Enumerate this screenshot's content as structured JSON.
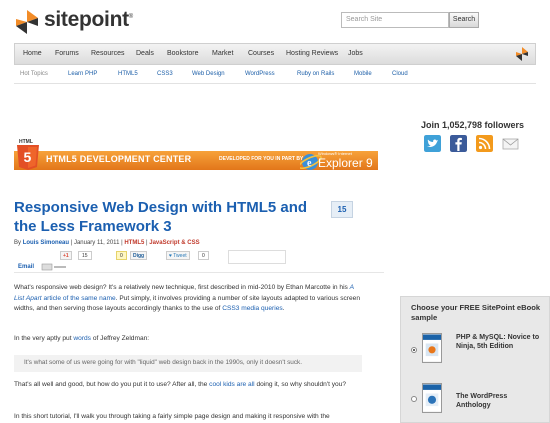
{
  "header": {
    "logo_text": "sitepoint",
    "logo_mark": "®",
    "search_placeholder": "Search Site",
    "search_button": "Search"
  },
  "nav": {
    "items": [
      "Home",
      "Forums",
      "Resources",
      "Deals",
      "Bookstore",
      "Market",
      "Courses",
      "Hosting Reviews",
      "Jobs"
    ]
  },
  "hot_topics": {
    "label": "Hot Topics",
    "links": [
      "Learn PHP",
      "HTML5",
      "CSS3",
      "Web Design",
      "WordPress",
      "Ruby on Rails",
      "Mobile",
      "Cloud"
    ]
  },
  "banner": {
    "badge_top": "HTML",
    "badge_num": "5",
    "title": "HTML5 DEVELOPMENT CENTER",
    "subtitle": "DEVELOPED FOR YOU IN PART BY",
    "ie_small": "Windows® Internet",
    "ie_big": "Explorer 9"
  },
  "article": {
    "title": "Responsive Web Design with HTML5 and the Less Framework 3",
    "comment_count": "15",
    "byline_prefix": "By",
    "author": "Louis Simoneau",
    "date": "January 11, 2011",
    "tag1": "HTML5",
    "tag2": "JavaScript & CSS",
    "share": {
      "gplus_label": "+1",
      "gplus_count": "15",
      "digg_count": "0",
      "digg_label": "Digg",
      "tweet_label": "Tweet",
      "tweet_count": "0",
      "email_label": "Email"
    },
    "p1_a": "What's responsive web design? It's a relatively new technique, first described in mid-2010 by Ethan Marcotte in his ",
    "p1_link1": "A List Apart",
    "p1_link2": "article of the same name",
    "p1_b": ". Put simply, it involves providing a number of site layouts adapted to various screen widths, and then serving those layouts accordingly thanks to the use of ",
    "p1_link3": "CSS3 media queries",
    "p1_c": ".",
    "p2_a": "In the very aptly put ",
    "p2_link": "words",
    "p2_b": " of Jeffrey Zeldman:",
    "quote": "It's what some of us were going for with \"liquid\" web design back in the 1990s, only it doesn't suck.",
    "p3_a": "That's all well and good, but how do you put it to use? After all, the ",
    "p3_link": "cool kids are all",
    "p3_b": " doing it, so why shouldn't you?",
    "p4": "In this short tutorial, I'll walk you through taking a fairly simple page design and making it responsive with the"
  },
  "sidebar": {
    "followers": "Join 1,052,798 followers",
    "social_icons": [
      "twitter-icon",
      "facebook-icon",
      "rss-icon",
      "email-icon"
    ],
    "ebook_title": "Choose your FREE SitePoint eBook sample",
    "book1_title": "PHP & MySQL: Novice to Ninja, 5th Edition",
    "book2_title": "The WordPress Anthology"
  },
  "colors": {
    "link": "#1b5fb0",
    "orange": "#e8771b",
    "title_blue": "#1b5fb0"
  }
}
